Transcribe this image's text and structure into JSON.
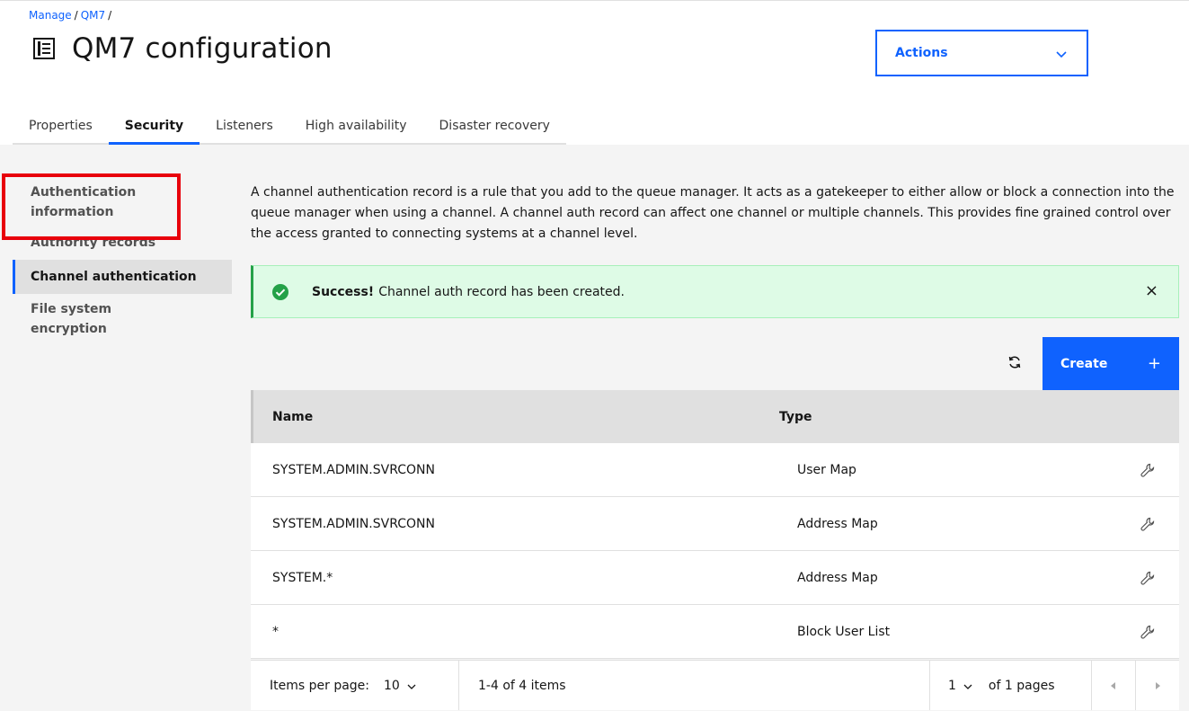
{
  "breadcrumb": {
    "root": "Manage",
    "current": "QM7",
    "sep": "/"
  },
  "page_title": "QM7 configuration",
  "actions": {
    "label": "Actions"
  },
  "tabs": [
    {
      "label": "Properties"
    },
    {
      "label": "Security"
    },
    {
      "label": "Listeners"
    },
    {
      "label": "High availability"
    },
    {
      "label": "Disaster recovery"
    }
  ],
  "side_nav": {
    "items": [
      {
        "label_line1": "Authentication",
        "label_line2": "information"
      },
      {
        "label": "Authority records"
      },
      {
        "label": "Channel authentication"
      },
      {
        "label_line1": "File system",
        "label_line2": "encryption"
      }
    ]
  },
  "description": "A channel authentication record is a rule that you add to the queue manager. It acts as a gatekeeper to either allow or block a connection into the queue manager when using a channel. A channel auth record can affect one channel or multiple channels. This provides fine grained control over the access granted to connecting systems at a channel level.",
  "notification": {
    "title": "Success!",
    "text": "Channel auth record has been created.",
    "close": "×"
  },
  "toolbar": {
    "create_label": "Create",
    "create_icon": "+"
  },
  "table": {
    "headers": {
      "name": "Name",
      "type": "Type"
    },
    "rows": [
      {
        "name": "SYSTEM.ADMIN.SVRCONN",
        "type": "User Map"
      },
      {
        "name": "SYSTEM.ADMIN.SVRCONN",
        "type": "Address Map"
      },
      {
        "name": "SYSTEM.*",
        "type": "Address Map"
      },
      {
        "name": "*",
        "type": "Block User List"
      }
    ]
  },
  "pagination": {
    "items_per_page_label": "Items per page:",
    "items_per_page": "10",
    "range": "1-4 of 4 items",
    "page": "1",
    "of_pages": "of 1 pages"
  },
  "colors": {
    "accent": "#0f62fe",
    "success": "#24a148",
    "highlight": "#e8000b"
  },
  "icons": {
    "title": "document-icon",
    "dropdown": "chevron-down-icon",
    "success": "checkmark-filled-icon",
    "refresh": "refresh-icon",
    "edit": "wrench-icon",
    "prev": "caret-left-icon",
    "next": "caret-right-icon"
  }
}
